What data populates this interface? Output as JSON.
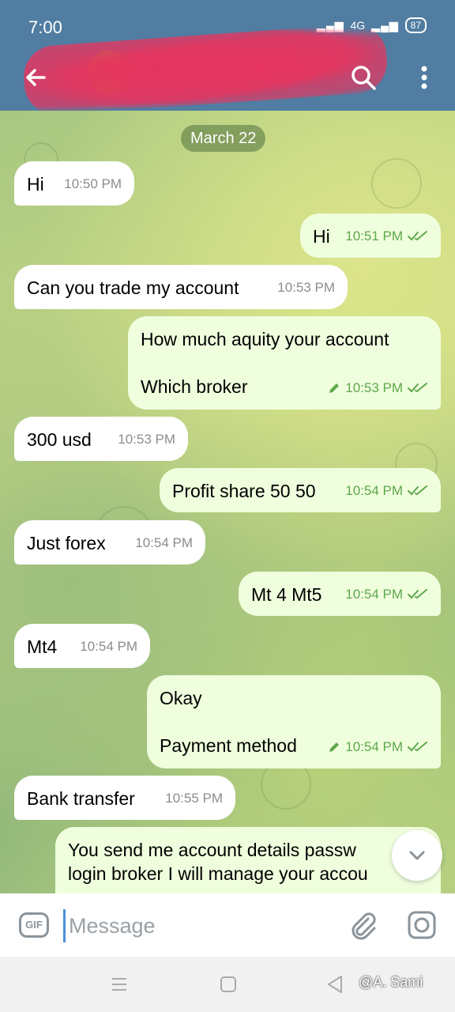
{
  "status_bar": {
    "time": "7:00",
    "network": "4G",
    "battery": "87"
  },
  "header": {
    "icons": [
      "back-arrow-icon",
      "search-icon",
      "more-vertical-icon"
    ]
  },
  "chat": {
    "date": "March 22",
    "messages": [
      {
        "side": "in",
        "lines": [
          "Hi"
        ],
        "time": "10:50 PM"
      },
      {
        "side": "out",
        "lines": [
          "Hi"
        ],
        "time": "10:51 PM",
        "read": true
      },
      {
        "side": "in",
        "lines": [
          "Can you trade my account"
        ],
        "time": "10:53 PM"
      },
      {
        "side": "out",
        "lines": [
          "How much aquity your account",
          "Which broker"
        ],
        "time": "10:53 PM",
        "edited": true,
        "read": true
      },
      {
        "side": "in",
        "lines": [
          "300 usd"
        ],
        "time": "10:53 PM"
      },
      {
        "side": "out",
        "lines": [
          "Profit share 50 50"
        ],
        "time": "10:54 PM",
        "read": true
      },
      {
        "side": "in",
        "lines": [
          "Just forex"
        ],
        "time": "10:54 PM"
      },
      {
        "side": "out",
        "lines": [
          "Mt 4 Mt5"
        ],
        "time": "10:54 PM",
        "read": true
      },
      {
        "side": "in",
        "lines": [
          "Mt4"
        ],
        "time": "10:54 PM"
      },
      {
        "side": "out",
        "lines": [
          "Okay",
          "Payment method"
        ],
        "time": "10:54 PM",
        "edited": true,
        "read": true
      },
      {
        "side": "in",
        "lines": [
          "Bank transfer"
        ],
        "time": "10:55 PM"
      },
      {
        "side": "out",
        "lines": [
          "You send me account details passw",
          "login broker I will manage your accou"
        ],
        "time": ""
      }
    ]
  },
  "input": {
    "placeholder": "Message",
    "gif_label": "GIF"
  },
  "watermark": "@A. Sami",
  "colors": {
    "header": "#517da2",
    "incoming_bubble": "#ffffff",
    "outgoing_bubble": "#effedd",
    "read_ticks": "#5fa84d"
  }
}
